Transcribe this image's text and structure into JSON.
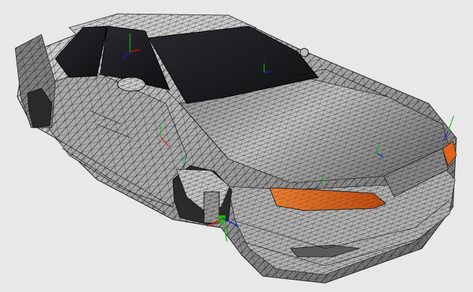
{
  "viewport": {
    "background": "#e8e8e8",
    "model": {
      "body_color": "#9a9a9a",
      "glass_color": "#1c1c1e",
      "wire_color": "#000000",
      "indicator_color": "#e0641a",
      "gizmo_colors": {
        "x": "#e01010",
        "y": "#10c010",
        "z": "#1020e0"
      }
    }
  }
}
